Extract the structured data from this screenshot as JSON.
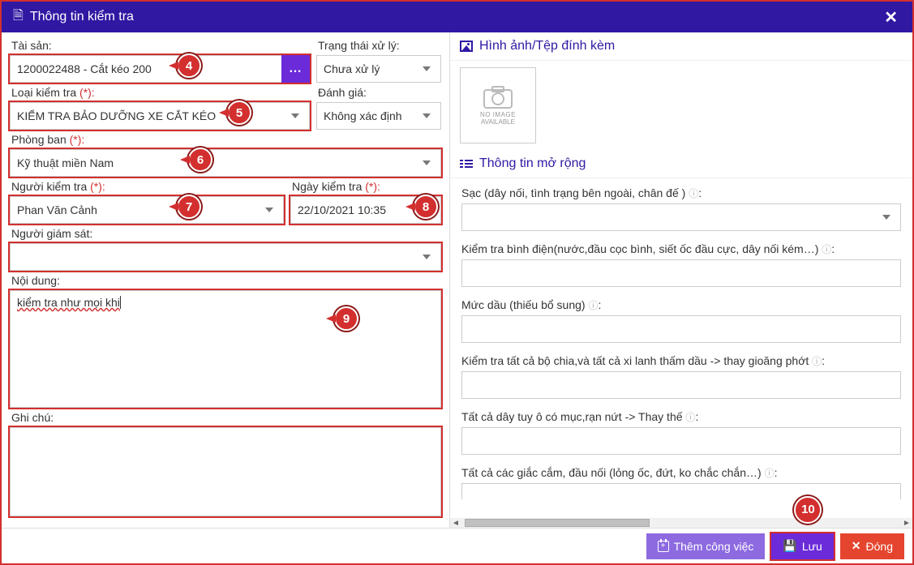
{
  "header": {
    "title": "Thông tin kiểm tra"
  },
  "left": {
    "asset_label": "Tài sản",
    "asset_value": "1200022488 - Cắt kéo 200",
    "status_label": "Trạng thái xử lý",
    "status_value": "Chưa xử lý",
    "type_label": "Loại kiểm tra",
    "type_value": "KIỂM TRA BẢO DƯỠNG XE CẮT KÉO",
    "rating_label": "Đánh giá",
    "rating_value": "Không xác định",
    "dept_label": "Phòng ban",
    "dept_value": "Kỹ thuật miền Nam",
    "inspector_label": "Người kiểm tra",
    "inspector_value": "Phan Văn Cảnh",
    "date_label": "Ngày kiểm tra",
    "date_value": "22/10/2021 10:35",
    "supervisor_label": "Người giám sát",
    "supervisor_value": "",
    "content_label": "Nội dung",
    "content_value": "kiểm tra như mọi khi",
    "notes_label": "Ghi chú",
    "notes_value": ""
  },
  "right": {
    "attach_title": "Hình ảnh/Tệp đính kèm",
    "noimg_line1": "NO IMAGE",
    "noimg_line2": "AVAILABLE",
    "ext_title": "Thông tin mở rộng",
    "fields": [
      {
        "label": "Sạc (dây nối, tình trạng bên ngoài, chân đế )",
        "value": "",
        "select": true
      },
      {
        "label": "Kiểm tra bình điện(nước,đầu cọc bình, siết ốc đầu cực, dây nối kém…)",
        "value": "",
        "select": false
      },
      {
        "label": "Mức dầu (thiếu bổ sung)",
        "value": "",
        "select": false
      },
      {
        "label": "Kiểm tra tất cả bộ chia,và tất cả xi lanh thấm dầu -> thay gioăng phớt",
        "value": "",
        "select": false
      },
      {
        "label": "Tất cả dây tuy ô có mục,rạn nứt -> Thay thế",
        "value": "",
        "select": false
      },
      {
        "label": "Tất cả các giắc cắm, đầu nối (lỏng ốc, đứt, ko chắc chắn…)",
        "value": "",
        "select": false
      }
    ]
  },
  "footer": {
    "add_job": "Thêm công việc",
    "save": "Lưu",
    "close": "Đóng"
  },
  "badges": [
    "4",
    "5",
    "6",
    "7",
    "8",
    "9",
    "10"
  ]
}
